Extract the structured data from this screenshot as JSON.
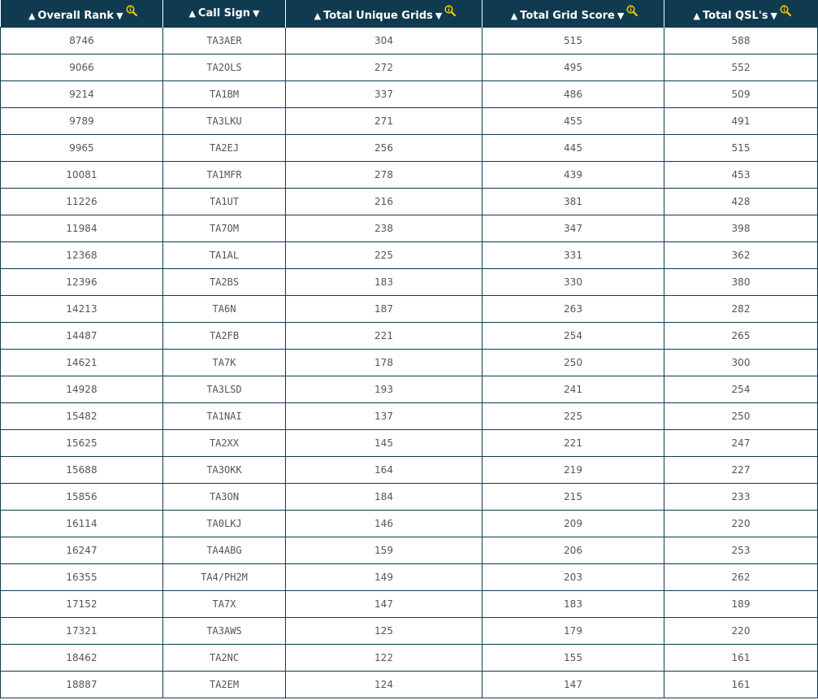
{
  "colors": {
    "header_bg": "#0f3a4f",
    "header_text": "#ffffff",
    "icon_color": "#f2c400",
    "cell_text": "#555555",
    "border": "#0f3a4f"
  },
  "table": {
    "sort_up_glyph": "▲",
    "sort_down_glyph": "▼",
    "headers": [
      {
        "label": "Overall Rank",
        "has_info_icon": true,
        "icon": "zoom-info-icon"
      },
      {
        "label": "Call Sign",
        "has_info_icon": false
      },
      {
        "label": "Total Unique Grids",
        "has_info_icon": true,
        "icon": "zoom-info-icon"
      },
      {
        "label": "Total Grid Score",
        "has_info_icon": true,
        "icon": "zoom-info-icon"
      },
      {
        "label": "Total QSL's",
        "has_info_icon": true,
        "icon": "zoom-info-icon"
      }
    ],
    "rows": [
      [
        "8746",
        "TA3AER",
        "304",
        "515",
        "588"
      ],
      [
        "9066",
        "TA2OLS",
        "272",
        "495",
        "552"
      ],
      [
        "9214",
        "TA1BM",
        "337",
        "486",
        "509"
      ],
      [
        "9789",
        "TA3LKU",
        "271",
        "455",
        "491"
      ],
      [
        "9965",
        "TA2EJ",
        "256",
        "445",
        "515"
      ],
      [
        "10081",
        "TA1MFR",
        "278",
        "439",
        "453"
      ],
      [
        "11226",
        "TA1UT",
        "216",
        "381",
        "428"
      ],
      [
        "11984",
        "TA7OM",
        "238",
        "347",
        "398"
      ],
      [
        "12368",
        "TA1AL",
        "225",
        "331",
        "362"
      ],
      [
        "12396",
        "TA2BS",
        "183",
        "330",
        "380"
      ],
      [
        "14213",
        "TA6N",
        "187",
        "263",
        "282"
      ],
      [
        "14487",
        "TA2FB",
        "221",
        "254",
        "265"
      ],
      [
        "14621",
        "TA7K",
        "178",
        "250",
        "300"
      ],
      [
        "14928",
        "TA3LSD",
        "193",
        "241",
        "254"
      ],
      [
        "15482",
        "TA1NAI",
        "137",
        "225",
        "250"
      ],
      [
        "15625",
        "TA2XX",
        "145",
        "221",
        "247"
      ],
      [
        "15688",
        "TA3OKK",
        "164",
        "219",
        "227"
      ],
      [
        "15856",
        "TA3ON",
        "184",
        "215",
        "233"
      ],
      [
        "16114",
        "TA0LKJ",
        "146",
        "209",
        "220"
      ],
      [
        "16247",
        "TA4ABG",
        "159",
        "206",
        "253"
      ],
      [
        "16355",
        "TA4/PH2M",
        "149",
        "203",
        "262"
      ],
      [
        "17152",
        "TA7X",
        "147",
        "183",
        "189"
      ],
      [
        "17321",
        "TA3AWS",
        "125",
        "179",
        "220"
      ],
      [
        "18462",
        "TA2NC",
        "122",
        "155",
        "161"
      ],
      [
        "18887",
        "TA2EM",
        "124",
        "147",
        "161"
      ]
    ]
  }
}
